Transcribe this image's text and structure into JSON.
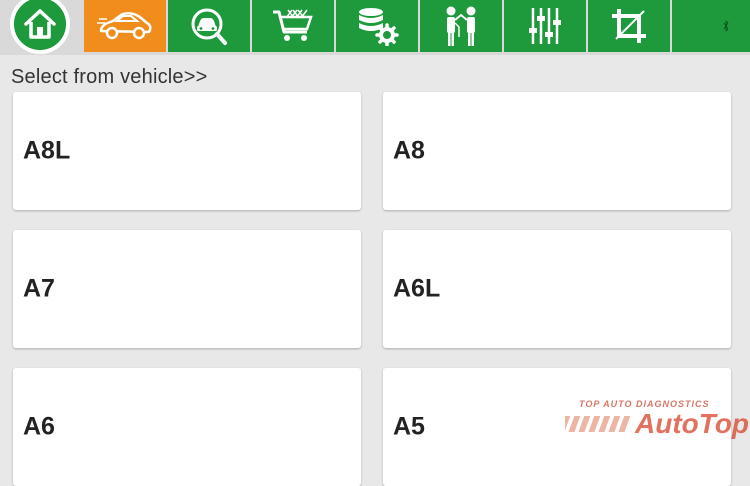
{
  "toolbar": {
    "tabs": [
      {
        "name": "home",
        "icon": "home-icon",
        "active": false
      },
      {
        "name": "vehicle-diagnosis",
        "icon": "car-icon",
        "active": true
      },
      {
        "name": "vehicle-search",
        "icon": "car-search-icon",
        "active": false
      },
      {
        "name": "shop",
        "icon": "shopping-cart-icon",
        "active": false
      },
      {
        "name": "data-settings",
        "icon": "database-gear-icon",
        "active": false
      },
      {
        "name": "user-support",
        "icon": "people-icon",
        "active": false
      },
      {
        "name": "adjustments",
        "icon": "sliders-icon",
        "active": false
      },
      {
        "name": "crop-screenshot",
        "icon": "crop-icon",
        "active": false
      },
      {
        "name": "bluetooth",
        "icon": "bluetooth-icon",
        "active": false
      }
    ],
    "colors": {
      "tab_green": "#1e9a3c",
      "tab_active_orange": "#f08d1c"
    }
  },
  "main": {
    "section_label": "Select from vehicle>>",
    "vehicles": [
      "A8L",
      "A8",
      "A7",
      "A6L",
      "A6",
      "A5"
    ]
  },
  "watermark": {
    "tagline": "TOP AUTO DIAGNOSTICS",
    "brand": "AutoTop"
  }
}
